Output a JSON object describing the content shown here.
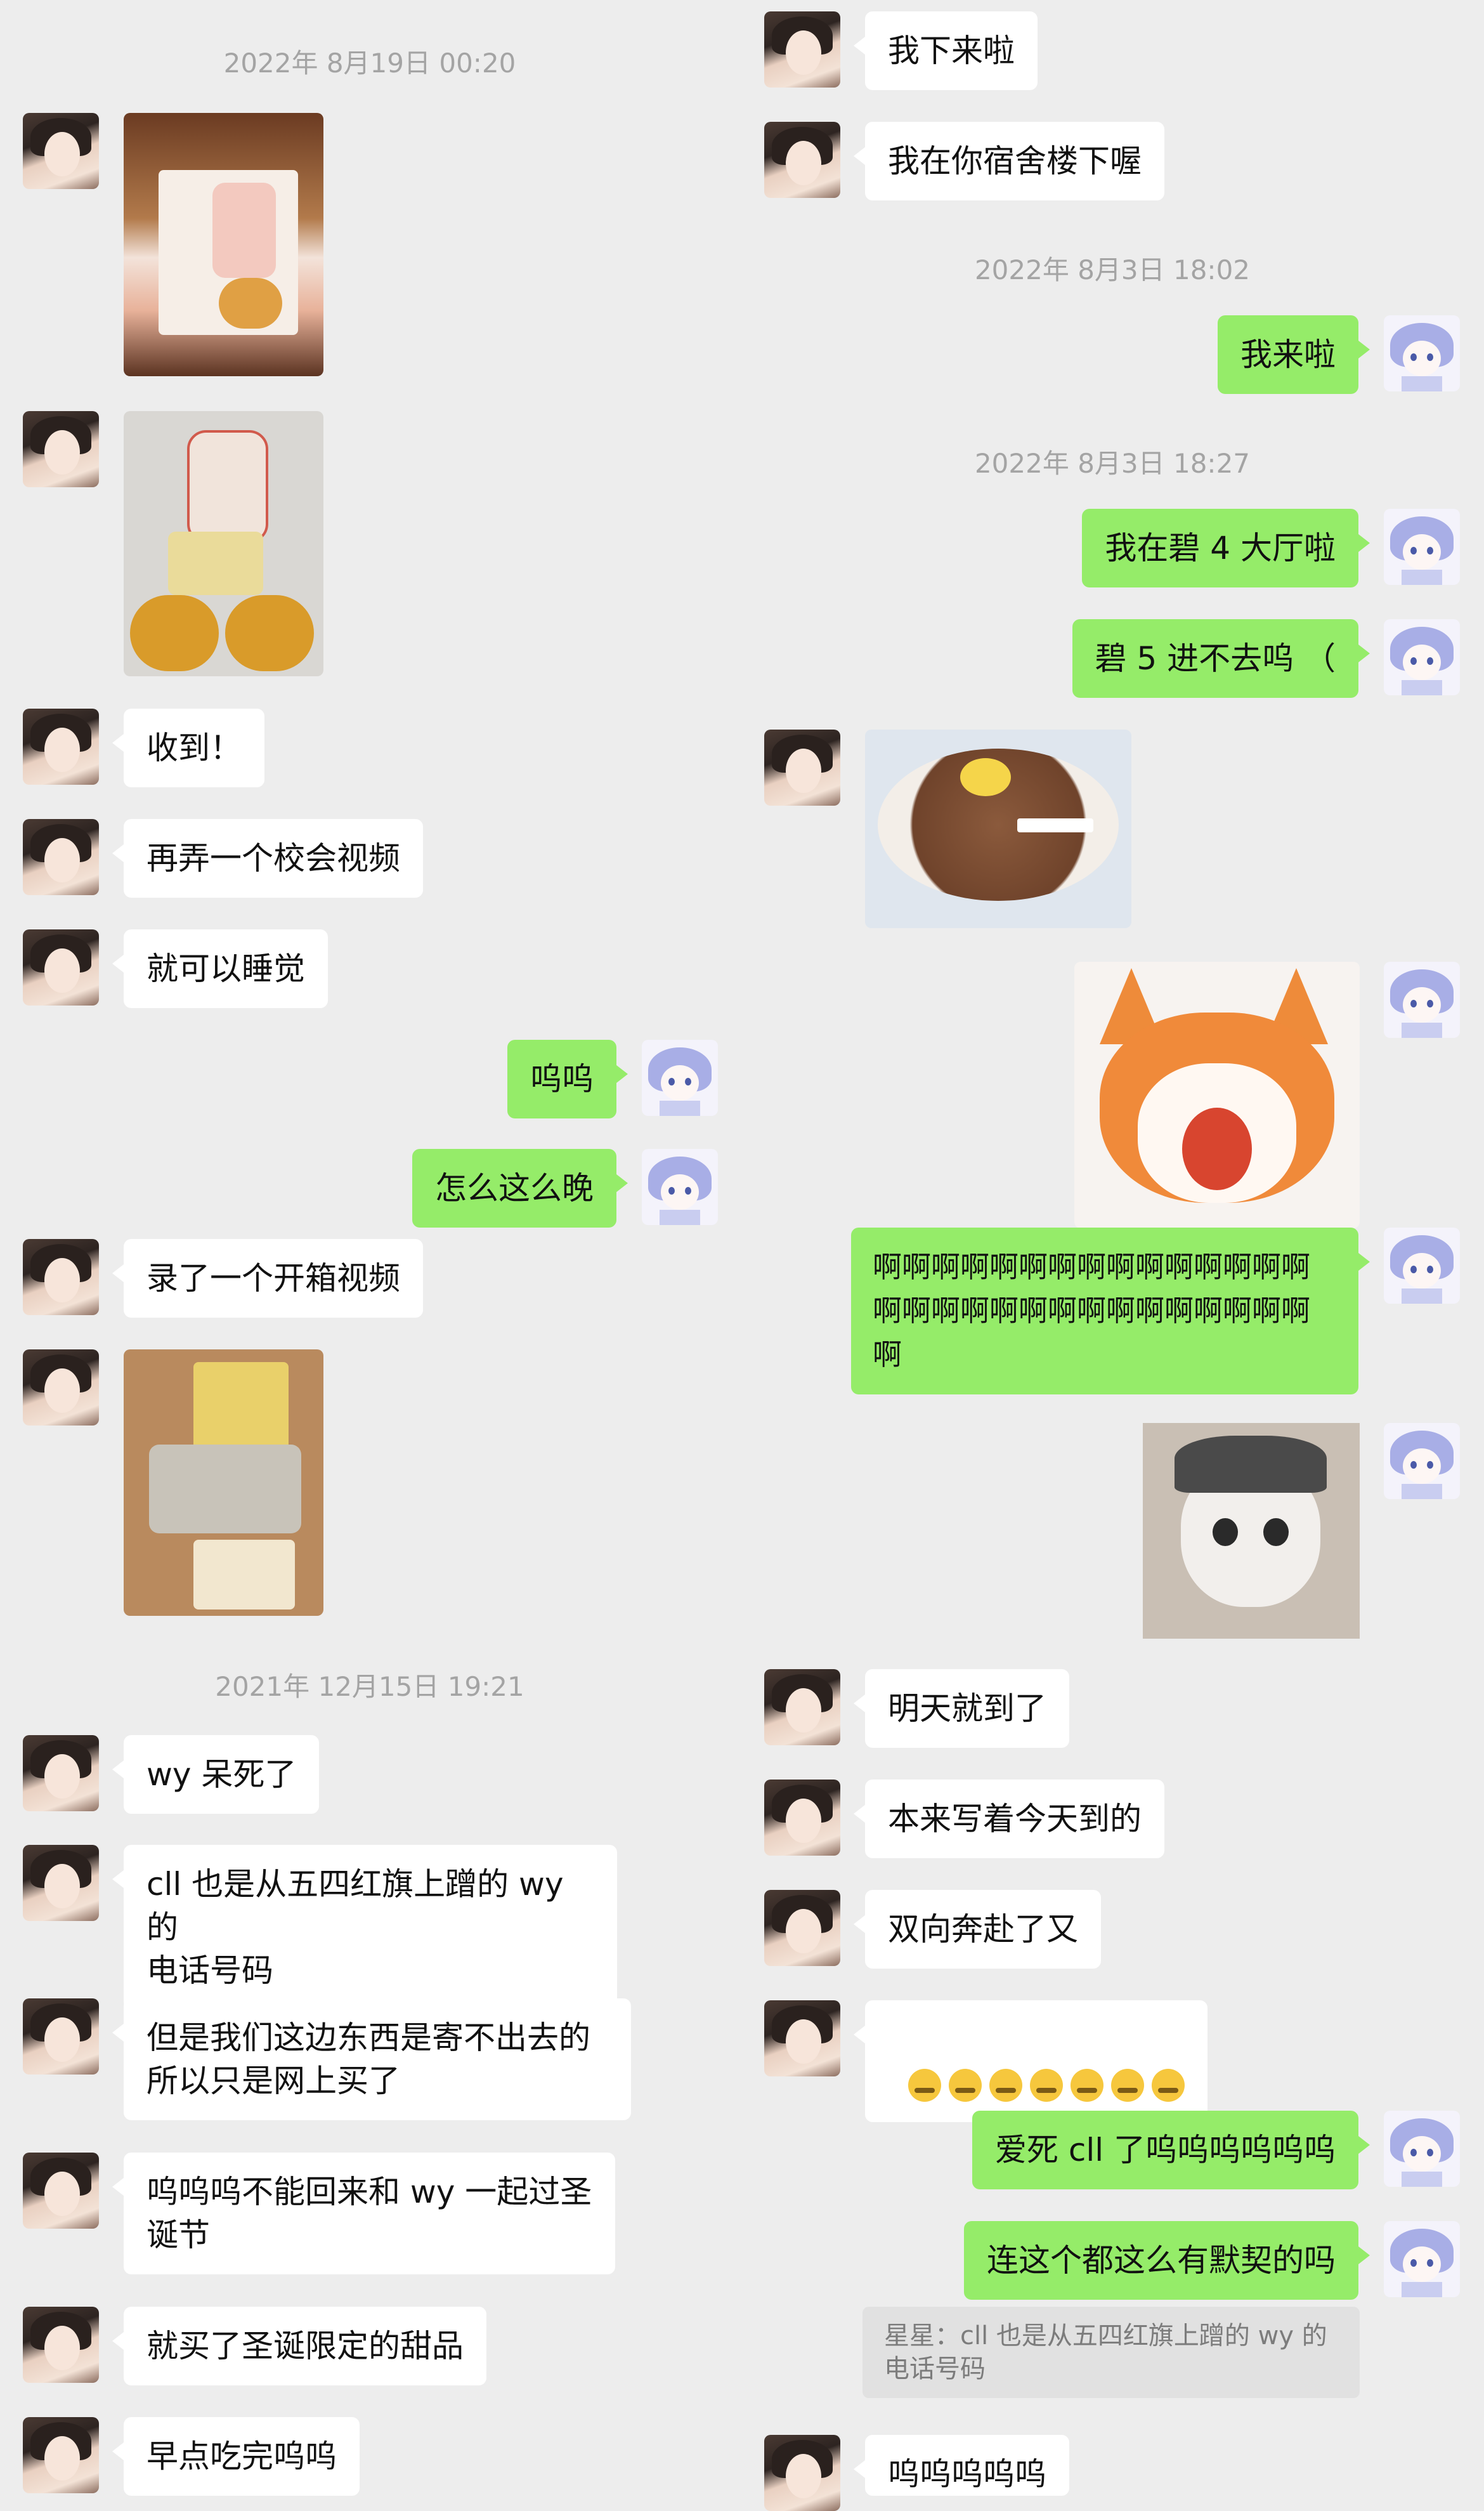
{
  "left": {
    "timestamp1": "2022年 8月19日 00:20",
    "msg_received": "收到！",
    "msg_school_video": "再弄一个校会视频",
    "msg_sleep": "就可以睡觉",
    "msg_wuwu": "呜呜",
    "msg_late": "怎么这么晚",
    "msg_unbox": "录了一个开箱视频",
    "timestamp2": "2021年 12月15日 19:21",
    "msg_wy": "wy 呆死了",
    "msg_cll": "cll 也是从五四红旗上蹭的 wy 的\n电话号码",
    "msg_ship": "但是我们这边东西是寄不出去的\n所以只是网上买了",
    "msg_xmas": "呜呜呜不能回来和 wy 一起过圣\n诞节",
    "msg_dessert": "就买了圣诞限定的甜品",
    "msg_eat": "早点吃完呜呜"
  },
  "right": {
    "msg_coming": "我下来啦",
    "msg_downstairs": "我在你宿舍楼下喔",
    "timestamp1": "2022年 8月3日 18:02",
    "msg_here": "我来啦",
    "timestamp2": "2022年 8月3日 18:27",
    "msg_hall": "我在碧 4 大厅啦",
    "msg_cant_enter": "碧 5 进不去呜 （",
    "msg_aaa": "啊啊啊啊啊啊啊啊啊啊啊啊啊啊啊\n啊啊啊啊啊啊啊啊啊啊啊啊啊啊啊\n啊",
    "msg_tomorrow": "明天就到了",
    "msg_today": "本来写着今天到的",
    "msg_both": "双向奔赴了又",
    "msg_love": "爱死 cll 了呜呜呜呜呜呜",
    "msg_tacit": "连这个都这么有默契的吗",
    "quote": "星星：cll 也是从五四红旗上蹭的 wy 的\n电话号码",
    "msg_last": "呜呜呜呜呜"
  },
  "emoji_count": 7,
  "colors": {
    "background": "#ededed",
    "my_bubble": "#95ec69",
    "their_bubble": "#ffffff",
    "timestamp": "#a4a4a4"
  }
}
